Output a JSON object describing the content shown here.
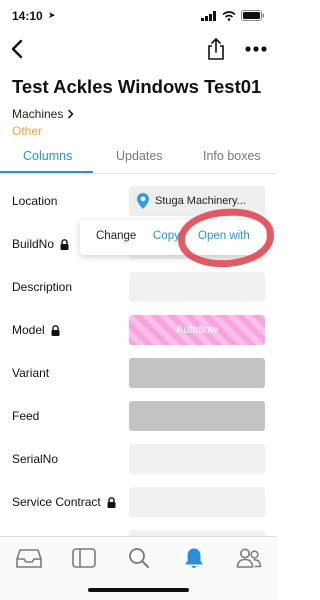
{
  "status_bar": {
    "time": "14:10"
  },
  "header": {
    "title": "Test Ackles Windows Test01",
    "breadcrumb": "Machines",
    "status": "Other"
  },
  "tabs": [
    {
      "label": "Columns",
      "active": true
    },
    {
      "label": "Updates",
      "active": false
    },
    {
      "label": "Info boxes",
      "active": false
    }
  ],
  "fields": {
    "location": {
      "label": "Location",
      "value": "Stuga Machinery..."
    },
    "buildno": {
      "label": "BuildNo"
    },
    "description": {
      "label": "Description"
    },
    "model": {
      "label": "Model",
      "value": "Autoflow"
    },
    "variant": {
      "label": "Variant"
    },
    "feed": {
      "label": "Feed"
    },
    "serialno": {
      "label": "SerialNo"
    },
    "service_contract": {
      "label": "Service Contract"
    }
  },
  "context_menu": {
    "change": "Change",
    "copy": "Copy",
    "open_with": "Open with"
  },
  "bottom_nav": [
    "inbox-icon",
    "sidebar-icon",
    "search-icon",
    "bell-icon",
    "people-icon"
  ],
  "colors": {
    "accent": "#2a8fd7",
    "status": "#f0a330",
    "annotation": "#e0434f",
    "autoflow": "#f6a3de"
  }
}
